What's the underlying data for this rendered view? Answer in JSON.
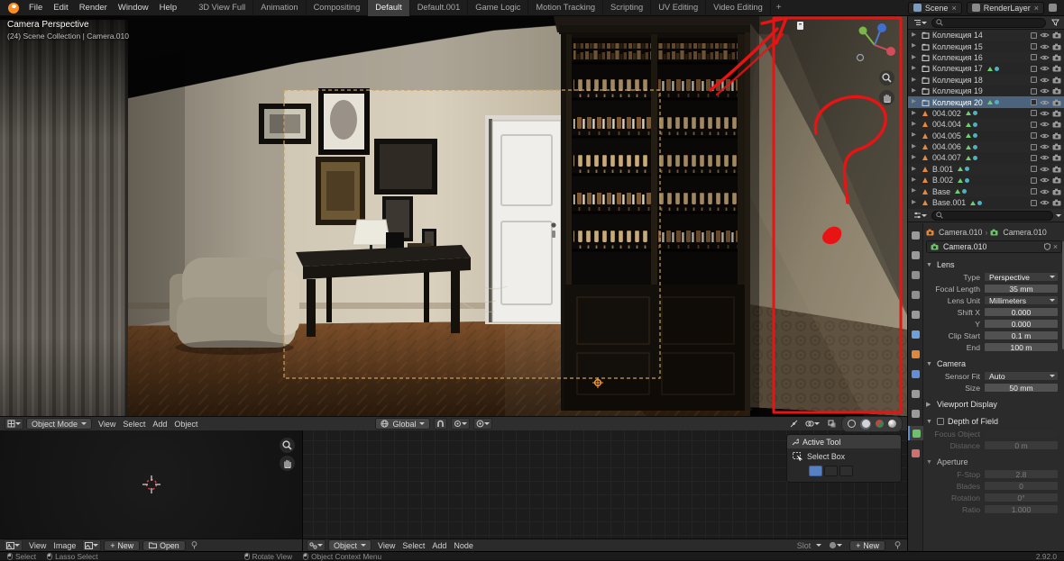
{
  "topbar": {
    "logo_icon": "blender-logo",
    "menus": [
      "File",
      "Edit",
      "Render",
      "Window",
      "Help"
    ],
    "tabs": [
      {
        "label": "3D View Full"
      },
      {
        "label": "Animation"
      },
      {
        "label": "Compositing"
      },
      {
        "label": "Default",
        "active": true
      },
      {
        "label": "Default.001"
      },
      {
        "label": "Game Logic"
      },
      {
        "label": "Motion Tracking"
      },
      {
        "label": "Scripting"
      },
      {
        "label": "UV Editing"
      },
      {
        "label": "Video Editing"
      }
    ],
    "add_tab_label": "+",
    "scene_selector": {
      "icon": "scene-browse-icon",
      "label": "Scene",
      "clear": "×"
    },
    "layer_selector": {
      "icon": "view-layer-icon",
      "label": "RenderLayer",
      "clear": "×"
    }
  },
  "viewport": {
    "overlay": {
      "line1": "Camera Perspective",
      "line2": "(24) Scene Collection | Camera.010"
    },
    "header": {
      "editor_icon": "editor-3d-viewport-icon",
      "mode": "Object Mode",
      "menus": [
        "View",
        "Select",
        "Add",
        "Object"
      ],
      "orientation": "Global",
      "center_icons": [
        "global-orientation-icon",
        "snap-magnet-icon",
        "snap-target-icon",
        "proportional-editing-icon"
      ],
      "right_icons": [
        "gizmo-icon",
        "overlays-icon",
        "xray-icon",
        "shading-wireframe-icon",
        "shading-solid-icon",
        "shading-material-icon",
        "shading-rendered-icon"
      ]
    },
    "nav_icons": [
      "axis-gizmo",
      "zoom-icon",
      "hand-icon"
    ]
  },
  "outliner": {
    "header_icons": [
      "editor-outliner-icon",
      "search-icon",
      "filter-funnel-icon"
    ],
    "items": [
      {
        "label": "Коллекция 14"
      },
      {
        "label": "Коллекция 15"
      },
      {
        "label": "Коллекция 16"
      },
      {
        "label": "Коллекция 17",
        "extras": true
      },
      {
        "label": "Коллекция 18"
      },
      {
        "label": "Коллекция 19"
      },
      {
        "label": "Коллекция 20",
        "selected": true,
        "extras": true
      },
      {
        "label": "004.002",
        "is_object": true,
        "extras": true
      },
      {
        "label": "004.004",
        "is_object": true,
        "extras": true
      },
      {
        "label": "004.005",
        "is_object": true,
        "extras": true
      },
      {
        "label": "004.006",
        "is_object": true,
        "extras": true
      },
      {
        "label": "004.007",
        "is_object": true,
        "extras": true
      },
      {
        "label": "B.001",
        "is_object": true,
        "extras": true
      },
      {
        "label": "B.002",
        "is_object": true,
        "extras": true
      },
      {
        "label": "Base",
        "is_object": true,
        "extras": true
      },
      {
        "label": "Base.001",
        "is_object": true,
        "extras": true
      }
    ]
  },
  "properties": {
    "header_icons": [
      "editor-properties-icon",
      "search-icon",
      "filter-icon"
    ],
    "tabs": [
      {
        "name": "tool-icon",
        "color": "#9a9a9a"
      },
      {
        "name": "render-icon",
        "color": "#9a9a9a"
      },
      {
        "name": "output-icon",
        "color": "#8f8f8f"
      },
      {
        "name": "view-layer-icon",
        "color": "#8f8f8f"
      },
      {
        "name": "scene-icon",
        "color": "#9a9a9a"
      },
      {
        "name": "world-icon",
        "color": "#6f9fd8"
      },
      {
        "name": "object-properties-icon",
        "color": "#e0873d"
      },
      {
        "name": "modifiers-icon",
        "color": "#5f8fd8"
      },
      {
        "name": "physics-icon",
        "color": "#9a9a9a"
      },
      {
        "name": "constraints-icon",
        "color": "#9a9a9a"
      },
      {
        "name": "object-data-icon",
        "color": "#6fbf6f",
        "active": true
      },
      {
        "name": "texture-icon",
        "color": "#d06f6f"
      }
    ],
    "breadcrumb": {
      "object": "Camera.010",
      "sep": "›",
      "data": "Camera.010"
    },
    "datablock_name": "Camera.010",
    "panels": {
      "lens": {
        "title": "Lens",
        "rows": [
          {
            "label": "Type",
            "value": "Perspective",
            "dd": true
          },
          {
            "label": "Focal Length",
            "value": "35 mm"
          },
          {
            "label": "Lens Unit",
            "value": "Millimeters",
            "dd": true
          },
          {
            "label": "Shift X",
            "value": "0.000"
          },
          {
            "label": "Y",
            "value": "0.000"
          },
          {
            "label": "Clip Start",
            "value": "0.1 m"
          },
          {
            "label": "End",
            "value": "100 m"
          }
        ]
      },
      "camera": {
        "title": "Camera",
        "rows": [
          {
            "label": "Sensor Fit",
            "value": "Auto",
            "dd": true
          },
          {
            "label": "Size",
            "value": "50 mm"
          }
        ]
      },
      "viewport_display": {
        "title": "Viewport Display"
      },
      "dof": {
        "title": "Depth of Field",
        "rows": [
          {
            "label": "Focus Object",
            "value": "",
            "field": true,
            "disabled": true
          },
          {
            "label": "Distance",
            "value": "0 m",
            "disabled": true
          }
        ]
      },
      "aperture": {
        "title": "Aperture",
        "rows": [
          {
            "label": "F-Stop",
            "value": "2.8",
            "disabled": true
          },
          {
            "label": "Blades",
            "value": "0",
            "disabled": true
          },
          {
            "label": "Rotation",
            "value": "0°",
            "disabled": true
          },
          {
            "label": "Ratio",
            "value": "1.000",
            "disabled": true
          }
        ]
      }
    }
  },
  "image_editor": {
    "editor_icon": "editor-image-icon",
    "menus": [
      "View",
      "Image"
    ],
    "datablock_icon": "image-datablock-icon",
    "new_label": "New",
    "open_label": "Open",
    "pin_icon": "pin-icon",
    "nav_icons": [
      "zoom-icon",
      "hand-icon"
    ]
  },
  "node_editor": {
    "editor_icon": "editor-node-icon",
    "type_label": "Object",
    "menus": [
      "View",
      "Select",
      "Add",
      "Node"
    ],
    "slot_label": "Slot",
    "new_label": "New",
    "pin_icon": "pin-icon",
    "active_tool": {
      "title": "Active Tool",
      "tool": "Select Box",
      "tool_icon": "select-box-icon"
    }
  },
  "statusbar": {
    "hints": [
      "Select",
      "Lasso Select",
      "Rotate View",
      "Object Context Menu"
    ],
    "version": "2.92.0"
  }
}
